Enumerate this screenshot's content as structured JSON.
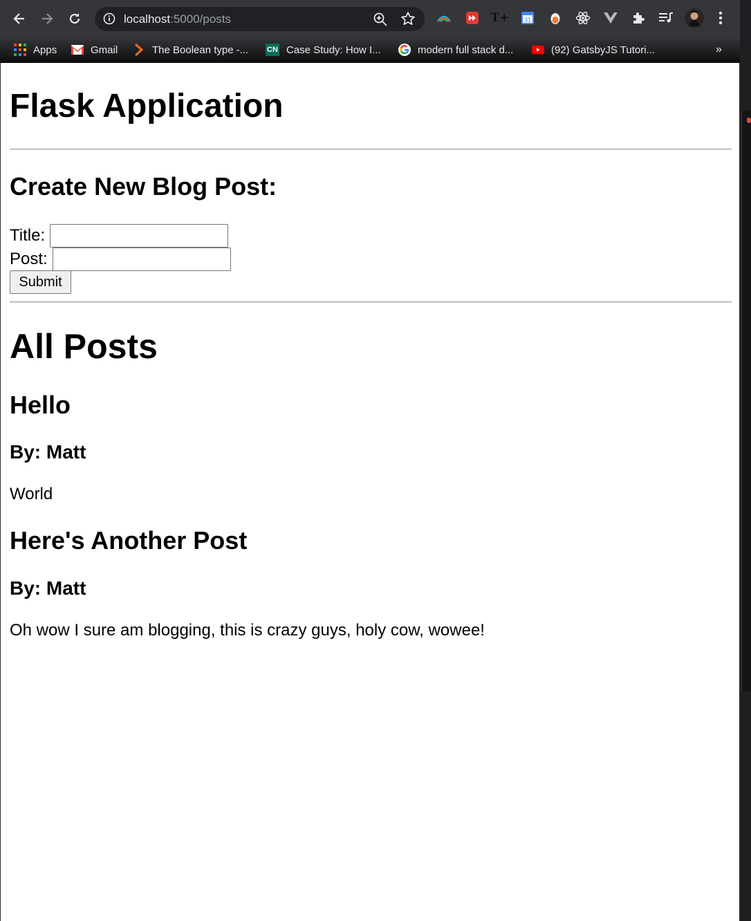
{
  "browser": {
    "url_host": "localhost",
    "url_path": ":5000/posts",
    "bookmarks": [
      {
        "label": "Apps",
        "icon": "apps-grid-icon"
      },
      {
        "label": "Gmail",
        "icon": "gmail-icon"
      },
      {
        "label": "The Boolean type -...",
        "icon": "chevron-bookmark-icon"
      },
      {
        "label": "Case Study: How I...",
        "icon": "cn-icon"
      },
      {
        "label": "modern full stack d...",
        "icon": "google-icon"
      },
      {
        "label": "(92) GatsbyJS Tutori...",
        "icon": "youtube-icon"
      }
    ],
    "overflow_label": "»",
    "extension_icons": [
      "rainbow-ext-icon",
      "fast-forward-ext-icon",
      "tt-ext-icon",
      "calendar-ext-icon",
      "egg-ext-icon",
      "react-ext-icon",
      "vue-ext-icon",
      "puzzle-extensions-icon",
      "media-playlist-icon",
      "profile-avatar",
      "kebab-menu-icon"
    ],
    "calendar_day": "31"
  },
  "page": {
    "title": "Flask Application",
    "create_heading": "Create New Blog Post:",
    "form": {
      "title_label": "Title:",
      "title_value": "",
      "post_label": "Post:",
      "post_value": "",
      "submit_label": "Submit"
    },
    "all_posts_heading": "All Posts",
    "posts": [
      {
        "title": "Hello",
        "author": "By: Matt",
        "body": "World"
      },
      {
        "title": "Here's Another Post",
        "author": "By: Matt",
        "body": "Oh wow I sure am blogging, this is crazy guys, holy cow, wowee!"
      }
    ]
  }
}
